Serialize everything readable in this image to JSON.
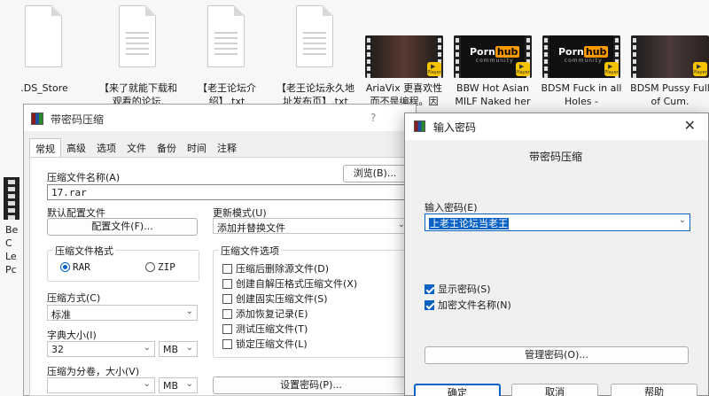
{
  "explorer": {
    "files": [
      {
        "name": ".DS_Store",
        "type": "doc"
      },
      {
        "name": "【来了就能下载和观看的论坛.",
        "type": "doc"
      },
      {
        "name": "【老王论坛介绍】.txt",
        "type": "doc"
      },
      {
        "name": "【老王论坛永久地址发布页】.txt",
        "type": "doc"
      },
      {
        "name": "AriaVix 更喜欢性而不是编程。因",
        "type": "video"
      },
      {
        "name": "BBW Hot Asian MILF Naked her",
        "type": "video",
        "thumb_logo": "Porn",
        "thumb_logo_hl": "hub"
      },
      {
        "name": "BDSM Fuck in all Holes -",
        "type": "video",
        "thumb_logo": "Porn",
        "thumb_logo_hl": "hub"
      },
      {
        "name": "BDSM Pussy Full of Cum.",
        "type": "video"
      }
    ],
    "thumb_sub": "community",
    "badge_label": "Player",
    "left_partial_text": "Be C Le Pc"
  },
  "rar_dialog": {
    "title": "带密码压缩",
    "help_glyph": "?",
    "tabs": [
      "常规",
      "高级",
      "选项",
      "文件",
      "备份",
      "时间",
      "注释"
    ],
    "archive_name_label": "压缩文件名称(A)",
    "archive_name_value": "17.rar",
    "browse_button": "浏览(B)...",
    "profile_label": "默认配置文件",
    "profile_button": "配置文件(F)...",
    "update_mode_label": "更新模式(U)",
    "update_mode_value": "添加并替换文件",
    "format_group": "压缩文件格式",
    "format_rar": "RAR",
    "format_zip": "ZIP",
    "options_group": "压缩文件选项",
    "options": [
      {
        "label": "压缩后删除源文件(D)",
        "checked": false
      },
      {
        "label": "创建自解压格式压缩文件(X)",
        "checked": false
      },
      {
        "label": "创建固实压缩文件(S)",
        "checked": false
      },
      {
        "label": "添加恢复记录(E)",
        "checked": false
      },
      {
        "label": "测试压缩文件(T)",
        "checked": false
      },
      {
        "label": "锁定压缩文件(L)",
        "checked": false
      }
    ],
    "method_label": "压缩方式(C)",
    "method_value": "标准",
    "dict_label": "字典大小(I)",
    "dict_value": "32",
    "dict_unit": "MB",
    "split_label": "压缩为分卷，大小(V)",
    "split_value": "",
    "split_unit": "MB",
    "set_password_button": "设置密码(P)..."
  },
  "password_dialog": {
    "title": "输入密码",
    "close_glyph": "✕",
    "heading": "带密码压缩",
    "password_label": "输入密码(E)",
    "password_value": "上老王论坛当老王",
    "show_password_label": "显示密码(S)",
    "show_password_checked": true,
    "encrypt_names_label": "加密文件名称(N)",
    "encrypt_names_checked": true,
    "manage_button": "管理密码(O)...",
    "ok_button": "确定",
    "cancel_button": "取消",
    "help_button": "帮助"
  }
}
